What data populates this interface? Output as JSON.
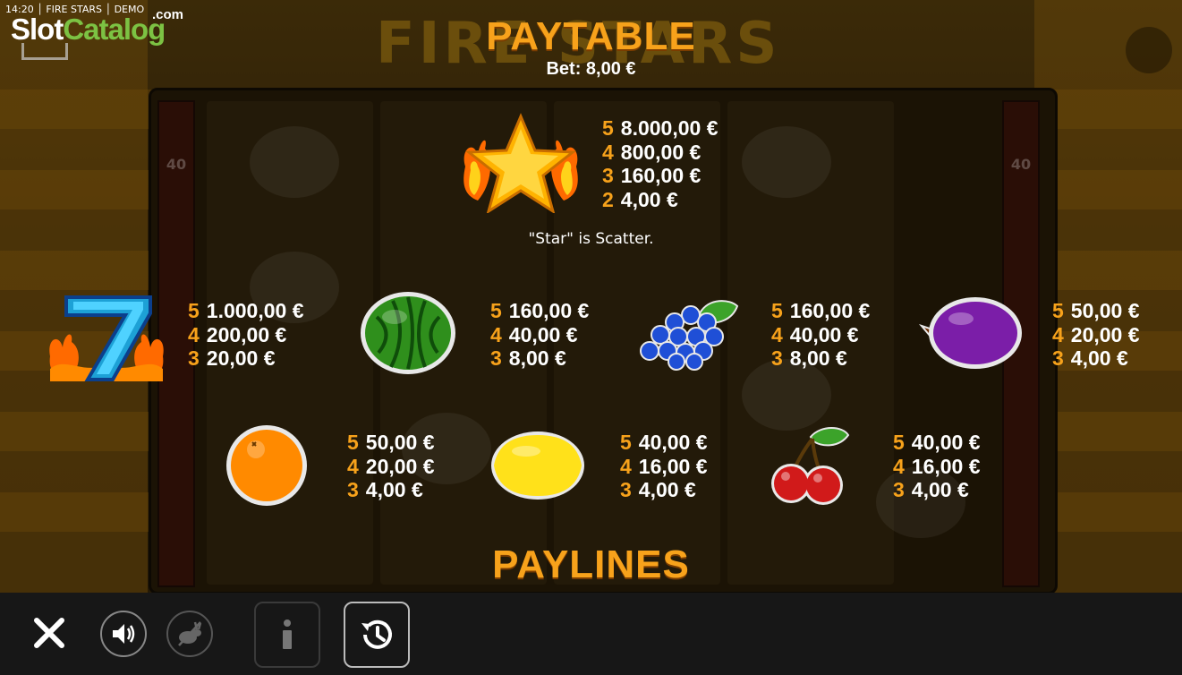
{
  "watermark": {
    "status_line": "14:20 │ FIRE STARS │ DEMO",
    "brand_left": "Slot",
    "brand_right": "Catalog",
    "brand_suffix": ".com"
  },
  "background": {
    "game_logo": "FIRE STARS",
    "meter_left": "40",
    "meter_right": "40"
  },
  "paytable": {
    "title": "PAYTABLE",
    "bet_line": "Bet: 8,00 €",
    "scatter_note": "\"Star\" is Scatter.",
    "symbols": [
      {
        "name": "star",
        "icon": "fire-star-icon",
        "pays": [
          {
            "n": "5",
            "v": "8.000,00 €"
          },
          {
            "n": "4",
            "v": "800,00 €"
          },
          {
            "n": "3",
            "v": "160,00 €"
          },
          {
            "n": "2",
            "v": "4,00 €"
          }
        ]
      },
      {
        "name": "seven",
        "icon": "fire-seven-icon",
        "pays": [
          {
            "n": "5",
            "v": "1.000,00 €"
          },
          {
            "n": "4",
            "v": "200,00 €"
          },
          {
            "n": "3",
            "v": "20,00 €"
          }
        ]
      },
      {
        "name": "watermelon",
        "icon": "watermelon-icon",
        "pays": [
          {
            "n": "5",
            "v": "160,00 €"
          },
          {
            "n": "4",
            "v": "40,00 €"
          },
          {
            "n": "3",
            "v": "8,00 €"
          }
        ]
      },
      {
        "name": "grapes",
        "icon": "grapes-icon",
        "pays": [
          {
            "n": "5",
            "v": "160,00 €"
          },
          {
            "n": "4",
            "v": "40,00 €"
          },
          {
            "n": "3",
            "v": "8,00 €"
          }
        ]
      },
      {
        "name": "plum",
        "icon": "plum-icon",
        "pays": [
          {
            "n": "5",
            "v": "50,00 €"
          },
          {
            "n": "4",
            "v": "20,00 €"
          },
          {
            "n": "3",
            "v": "4,00 €"
          }
        ]
      },
      {
        "name": "orange",
        "icon": "orange-icon",
        "pays": [
          {
            "n": "5",
            "v": "50,00 €"
          },
          {
            "n": "4",
            "v": "20,00 €"
          },
          {
            "n": "3",
            "v": "4,00 €"
          }
        ]
      },
      {
        "name": "lemon",
        "icon": "lemon-icon",
        "pays": [
          {
            "n": "5",
            "v": "40,00 €"
          },
          {
            "n": "4",
            "v": "16,00 €"
          },
          {
            "n": "3",
            "v": "4,00 €"
          }
        ]
      },
      {
        "name": "cherries",
        "icon": "cherries-icon",
        "pays": [
          {
            "n": "5",
            "v": "40,00 €"
          },
          {
            "n": "4",
            "v": "16,00 €"
          },
          {
            "n": "3",
            "v": "4,00 €"
          }
        ]
      }
    ]
  },
  "paylines": {
    "title": "PAYLINES"
  },
  "bottom_bar": {
    "buttons": [
      "close-icon",
      "sound-icon",
      "turbo-icon",
      "info-icon",
      "history-icon"
    ]
  },
  "colors": {
    "accent": "#f7a21b",
    "bar": "#171717",
    "brand_green": "#7cc243"
  }
}
